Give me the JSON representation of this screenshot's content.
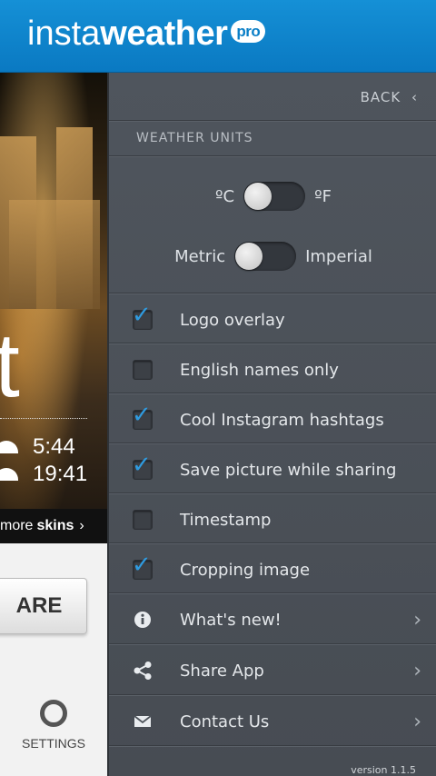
{
  "header": {
    "logo_part1": "insta",
    "logo_part2": "weather",
    "logo_badge": "pro"
  },
  "left_pane": {
    "big_letter": "t",
    "sunrise_time": "5:44",
    "sunset_time": "19:41",
    "skins_prefix": "more",
    "skins_bold": "skins",
    "share_label": "ARE",
    "settings_label": "SETTINGS"
  },
  "panel": {
    "back_label": "BACK",
    "section_title": "WEATHER UNITS",
    "temp_toggle": {
      "left": "ºC",
      "right": "ºF"
    },
    "unit_toggle": {
      "left": "Metric",
      "right": "Imperial"
    },
    "checkboxes": [
      {
        "label": "Logo overlay",
        "checked": true
      },
      {
        "label": "English names only",
        "checked": false
      },
      {
        "label": "Cool Instagram hashtags",
        "checked": true
      },
      {
        "label": "Save picture while sharing",
        "checked": true
      },
      {
        "label": "Timestamp",
        "checked": false
      },
      {
        "label": "Cropping image",
        "checked": true
      }
    ],
    "links": [
      {
        "label": "What's new!",
        "icon": "info-icon"
      },
      {
        "label": "Share App",
        "icon": "share-icon"
      },
      {
        "label": "Contact Us",
        "icon": "envelope-icon"
      }
    ],
    "version": "version 1.1.5"
  }
}
